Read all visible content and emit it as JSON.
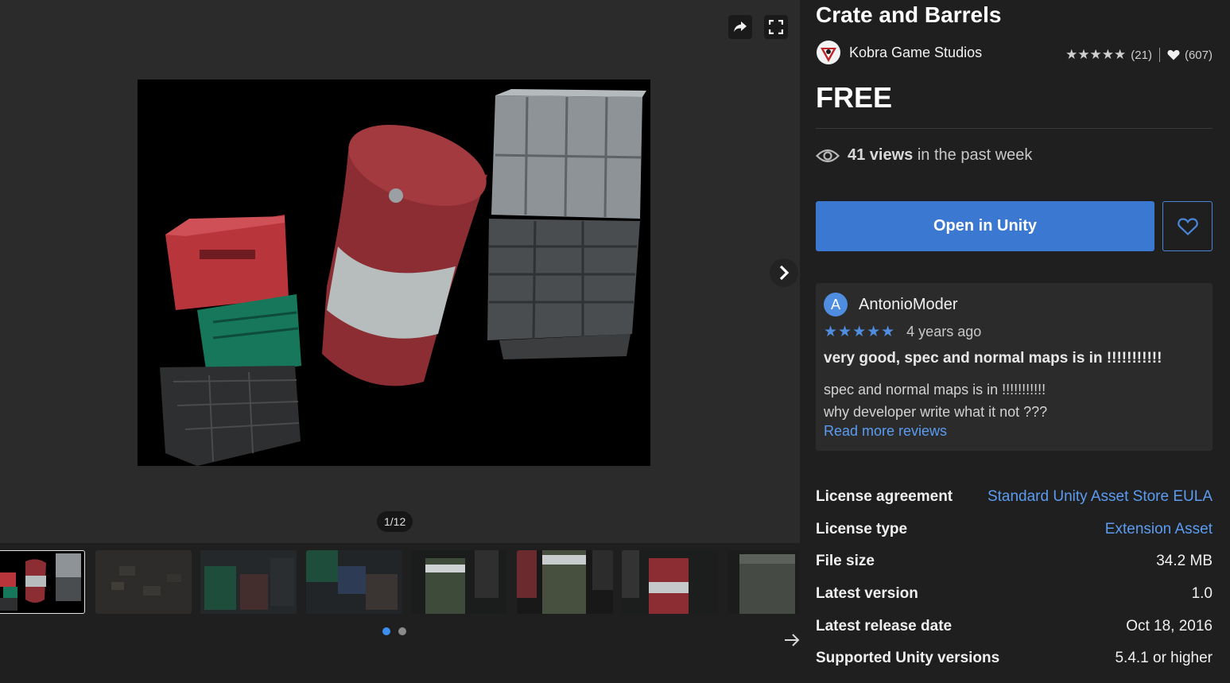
{
  "gallery": {
    "counter": "1/12",
    "thumbnail_count": 8,
    "active_thumbnail": 0,
    "page_dots": 2,
    "active_dot": 0,
    "icons": {
      "share": "share-arrow-icon",
      "fullscreen": "fullscreen-icon",
      "next": "chevron-right-icon",
      "thumbs_next": "arrow-right-icon"
    }
  },
  "product": {
    "title": "Crate and Barrels",
    "publisher": "Kobra Game Studios",
    "rating_count": "(21)",
    "favorites_count": "(607)",
    "price": "FREE",
    "views_count": "41 views",
    "views_suffix": "in the past week",
    "open_button": "Open in Unity"
  },
  "review": {
    "avatar_letter": "A",
    "user": "AntonioModer",
    "stars": 5,
    "time": "4 years ago",
    "title": "very good, spec and normal maps is in !!!!!!!!!!!",
    "body_line1": "spec and normal maps is in !!!!!!!!!!!",
    "body_line2": "why developer write what it not ???",
    "read_more": "Read more reviews"
  },
  "details": [
    {
      "label": "License agreement",
      "value": "Standard Unity Asset Store EULA",
      "link": true
    },
    {
      "label": "License type",
      "value": "Extension Asset",
      "link": true
    },
    {
      "label": "File size",
      "value": "34.2 MB",
      "link": false
    },
    {
      "label": "Latest version",
      "value": "1.0",
      "link": false
    },
    {
      "label": "Latest release date",
      "value": "Oct 18, 2016",
      "link": false
    },
    {
      "label": "Supported Unity versions",
      "value": "5.4.1 or higher",
      "link": false
    }
  ],
  "colors": {
    "accent": "#3b78d1",
    "link": "#5b9cf0",
    "background": "#1f1f20",
    "panel": "#2b2b2c"
  }
}
